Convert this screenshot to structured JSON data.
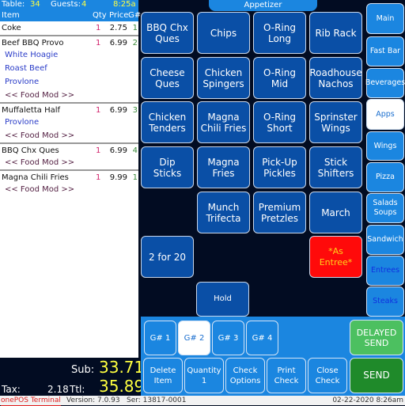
{
  "header": {
    "table_label": "Table:",
    "table": "34",
    "guests_label": "Guests:",
    "guests": "4",
    "time": "8:25a",
    "col_item": "Item",
    "col_qty": "Qty",
    "col_price": "Price",
    "col_g": "G#"
  },
  "order": [
    {
      "type": "item",
      "name": "Coke",
      "qty": "1",
      "price": "2.75",
      "g": "1"
    },
    {
      "type": "item",
      "name": "Beef BBQ Provo",
      "qty": "1",
      "price": "6.99",
      "g": "2"
    },
    {
      "type": "mod",
      "name": "White Hoagie"
    },
    {
      "type": "mod",
      "name": "Roast Beef"
    },
    {
      "type": "mod",
      "name": "Provlone"
    },
    {
      "type": "fm",
      "name": "<< Food Mod >>"
    },
    {
      "type": "item",
      "name": "Muffaletta Half",
      "qty": "1",
      "price": "6.99",
      "g": "3"
    },
    {
      "type": "mod",
      "name": "Provlone"
    },
    {
      "type": "fm",
      "name": "<< Food Mod >>"
    },
    {
      "type": "item",
      "name": "BBQ Chx Ques",
      "qty": "1",
      "price": "6.99",
      "g": "4"
    },
    {
      "type": "fm",
      "name": "<< Food Mod >>"
    },
    {
      "type": "item",
      "name": "Magna Chili Fries",
      "qty": "1",
      "price": "9.99",
      "g": "1"
    },
    {
      "type": "fm",
      "name": "<< Food Mod >>"
    }
  ],
  "totals": {
    "sub_label": "Sub:",
    "sub": "33.71",
    "tax_label": "Tax:",
    "tax": "2.18",
    "ttl_label": "Ttl:",
    "ttl": "35.89"
  },
  "status": {
    "app": "onePOS Terminal",
    "version": "Version: 7.0.93",
    "serial": "Ser: 13817-0001",
    "datetime": "02-22-2020  8:26am"
  },
  "category_title": "Appetizer",
  "menu": [
    [
      "BBQ Chx Ques",
      "Chips",
      "O-Ring Long",
      "Rib Rack"
    ],
    [
      "Cheese Ques",
      "Chicken Spingers",
      "O-Ring Mid",
      "Roadhouse Nachos"
    ],
    [
      "Chicken Tenders",
      "Magna Chili Fries",
      "O-Ring Short",
      "Sprinster Wings"
    ],
    [
      "Dip Sticks",
      "Magna Fries",
      "Pick-Up Pickles",
      "Stick Shifters"
    ],
    [
      "",
      "Munch Trifecta",
      "Premium Pretzles",
      "March"
    ],
    [
      "2 for 20",
      "",
      "",
      "*As Entree*"
    ]
  ],
  "hold": "Hold",
  "sidebar": [
    "Main",
    "Fast Bar",
    "Beverages",
    "Apps",
    "Wings",
    "Pizza",
    "Salads Soups",
    "Sandwich",
    "Entrees",
    "Steaks"
  ],
  "sidebar_active": "Apps",
  "guests_buttons": [
    "G# 1",
    "G# 2",
    "G# 3",
    "G# 4"
  ],
  "guest_active": "G# 2",
  "actions": [
    "Delete Item",
    "Quantity 1",
    "Check Options",
    "Print Check",
    "Close Check"
  ],
  "delayed_send": "DELAYED SEND",
  "send": "SEND",
  "colors": {
    "accent": "#1b86e0",
    "button": "#0a4fa6",
    "entree": "#ff0a0a",
    "send": "#1f8a2a",
    "delayed": "#4cc060"
  }
}
